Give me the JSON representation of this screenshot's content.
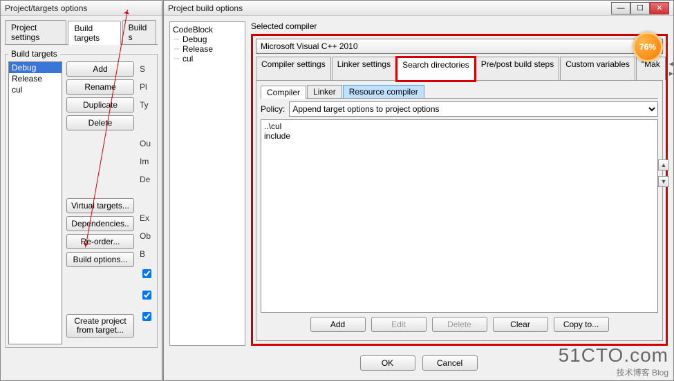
{
  "win1": {
    "title": "Project/targets options",
    "tabs": [
      "Project settings",
      "Build targets",
      "Build s"
    ],
    "active_tab": 1,
    "legend": "Build targets",
    "targets": [
      "Debug",
      "Release",
      "cul"
    ],
    "selected_target": 0,
    "buttons_top": {
      "add": "Add",
      "rename": "Rename",
      "duplicate": "Duplicate",
      "delete": "Delete"
    },
    "buttons_mid": {
      "virtual": "Virtual targets...",
      "deps": "Dependencies..",
      "reorder": "Re-order...",
      "buildopts": "Build options..."
    },
    "buttons_bottom": {
      "create": "Create project from target..."
    },
    "cut_labels": [
      "S",
      "Pl",
      "Ty",
      "Ou",
      "Im",
      "De",
      "Ex",
      "Ob",
      "B"
    ]
  },
  "win2": {
    "title": "Project build options",
    "tree": {
      "root": "CodeBlock",
      "children": [
        "Debug",
        "Release",
        "cul"
      ]
    },
    "selected_compiler_label": "Selected compiler",
    "selected_compiler": "Microsoft Visual C++ 2010",
    "main_tabs": [
      "Compiler settings",
      "Linker settings",
      "Search directories",
      "Pre/post build steps",
      "Custom variables",
      "\"Mak"
    ],
    "active_main_tab": 2,
    "sub_tabs": [
      "Compiler",
      "Linker",
      "Resource compiler"
    ],
    "active_sub_tab": 0,
    "policy_label": "Policy:",
    "policy_value": "Append target options to project options",
    "dir_list": "..\\cul\ninclude",
    "dir_buttons": {
      "add": "Add",
      "edit": "Edit",
      "delete": "Delete",
      "clear": "Clear",
      "copy": "Copy to..."
    },
    "dlg": {
      "ok": "OK",
      "cancel": "Cancel"
    }
  },
  "badge": "76%",
  "watermark": {
    "big": "51CTO.com",
    "sub": "技术博客    Blog"
  }
}
